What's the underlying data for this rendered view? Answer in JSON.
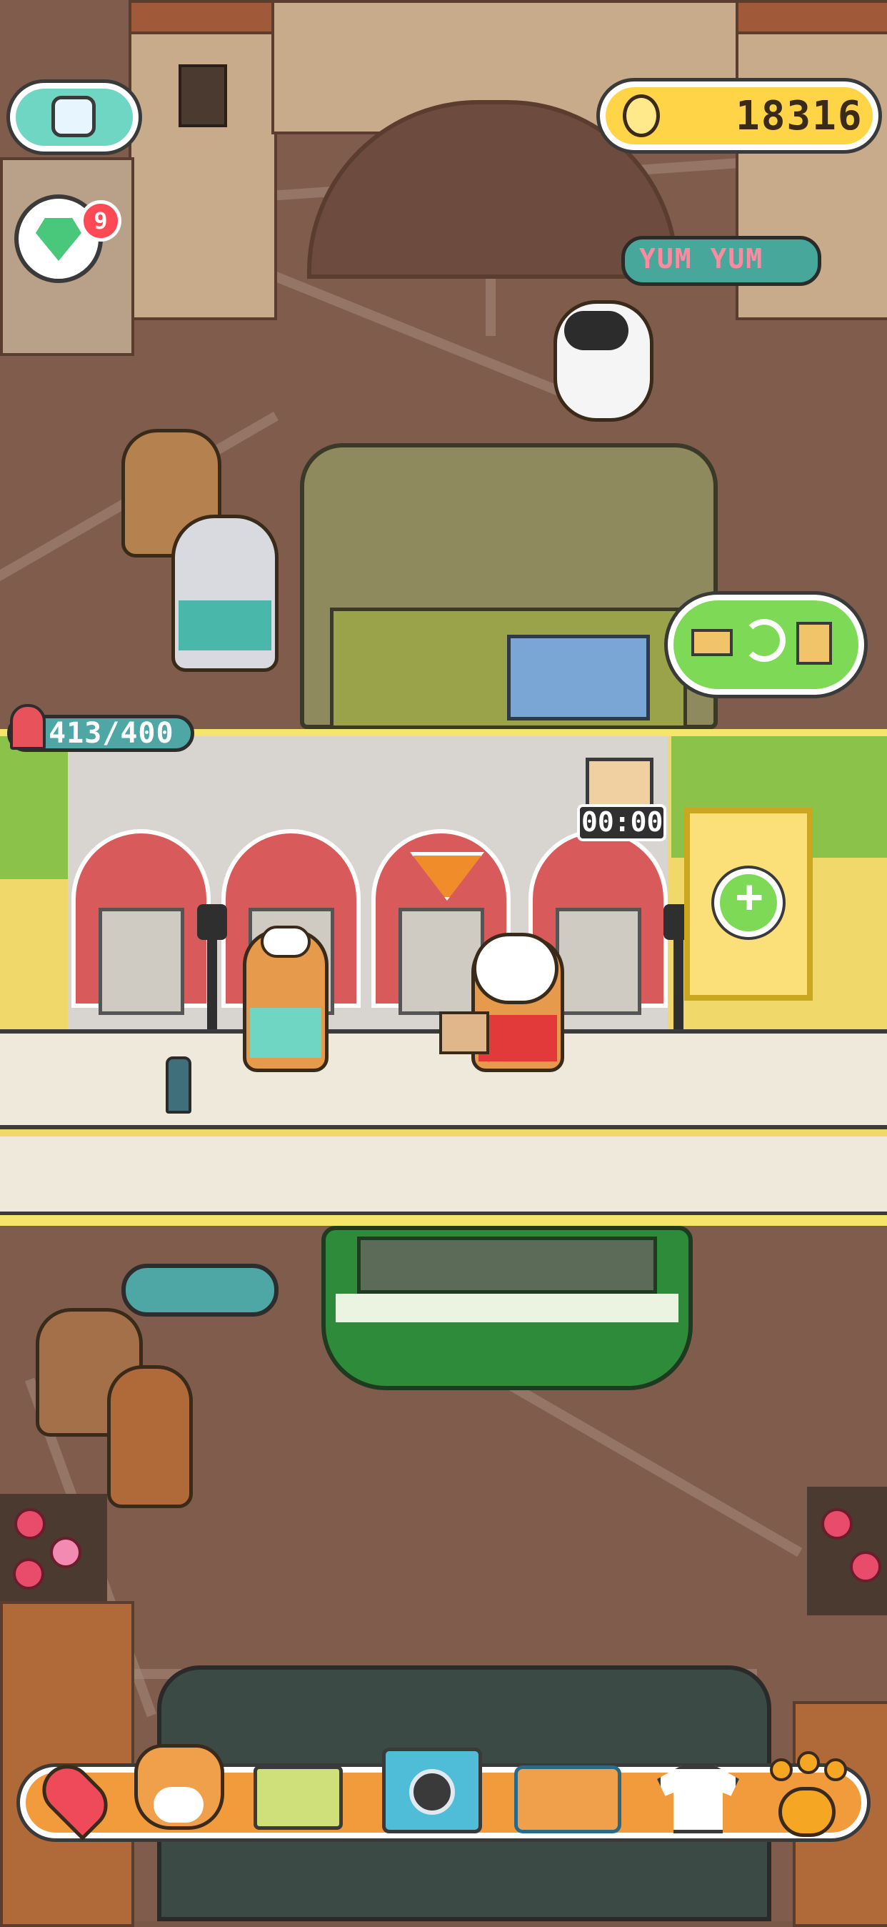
{
  "hud": {
    "coins": "18316",
    "gem_badge_count": "9",
    "capacity": "413/400",
    "timer": "00:00",
    "speech_bubble": "YUM YUM"
  },
  "navigation": {
    "items": [
      {
        "name": "map-pin-icon",
        "label": ""
      },
      {
        "name": "shiba-dog-icon",
        "label": ""
      },
      {
        "name": "cash-register-icon",
        "label": ""
      },
      {
        "name": "camera-icon",
        "label": ""
      },
      {
        "name": "sofa-icon",
        "label": ""
      },
      {
        "name": "shirt-icon",
        "label": ""
      },
      {
        "name": "paw-icon",
        "label": ""
      }
    ]
  },
  "colors": {
    "accent": "#f29b3c",
    "coin_pill": "#ffd447",
    "green_button": "#7ed957",
    "badge": "#ff4a56",
    "teal_pill": "#4fa7a5"
  }
}
